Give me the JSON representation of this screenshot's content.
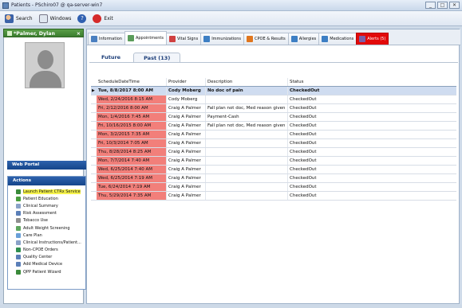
{
  "window": {
    "title": "Patients - PSchiro07 @ qa-server-win7",
    "buttons": [
      "_",
      "□",
      "✕"
    ]
  },
  "toolbar": {
    "search": "Search",
    "windows": "Windows",
    "exit": "Exit"
  },
  "patient": {
    "name": "*Palmer, Dylan",
    "close": "×"
  },
  "left": {
    "web_portal": "Web Portal",
    "actions_title": "Actions",
    "actions": [
      {
        "label": "Launch Patient CTRx Service",
        "color": "#3a8a3a"
      },
      {
        "label": "Patient Education",
        "color": "#4a9e3e"
      },
      {
        "label": "Clinical Summary",
        "color": "#8aa2c8"
      },
      {
        "label": "Risk Assessment",
        "color": "#5b7fb8"
      },
      {
        "label": "Tobacco Use",
        "color": "#8f8f8f"
      },
      {
        "label": "Adult Weight Screening",
        "color": "#5ea55e"
      },
      {
        "label": "Care Plan",
        "color": "#6aa0d8"
      },
      {
        "label": "Clinical Instructions/Patient...",
        "color": "#8aa2c8"
      },
      {
        "label": "Non-CPOE Orders",
        "color": "#2f8f4f"
      },
      {
        "label": "Quality Center",
        "color": "#5b7fb8"
      },
      {
        "label": "Add Medical Device",
        "color": "#5b7fb8"
      },
      {
        "label": "QPP Patient Wizard",
        "color": "#3a8a3a"
      }
    ]
  },
  "tabs": [
    {
      "label": "Information",
      "icon": "person-icon",
      "color": "#4a7fc0"
    },
    {
      "label": "Appointments",
      "icon": "calendar-icon",
      "color": "#5a9c5a"
    },
    {
      "label": "Vital Signs",
      "icon": "heart-icon",
      "color": "#d04040"
    },
    {
      "label": "Immunizations",
      "icon": "syringe-icon",
      "color": "#3d7fc4"
    },
    {
      "label": "CPOE & Results",
      "icon": "orders-icon",
      "color": "#e0761e"
    },
    {
      "label": "Allergies",
      "icon": "syringe-icon",
      "color": "#3d7fc4"
    },
    {
      "label": "Medications",
      "icon": "syringe-icon",
      "color": "#3d7fc4"
    },
    {
      "label": "Alerts (5)",
      "icon": "alert-icon",
      "color": "#7a5fa8"
    }
  ],
  "subtabs": {
    "future": "Future",
    "past": "Past (13)"
  },
  "grid": {
    "headers": [
      "ScheduleDateTime",
      "Provider",
      "Description",
      "Status"
    ],
    "rows": [
      [
        "Tue, 8/8/2017 8:00 AM",
        "Cody Moberg",
        "No doc of pain",
        "CheckedOut"
      ],
      [
        "Wed, 2/24/2016 8:15 AM",
        "Cody Moberg",
        "",
        "CheckedOut"
      ],
      [
        "Fri, 2/12/2016 8:00 AM",
        "Craig A Palmer",
        "Fall plan not doc, Med reason given",
        "CheckedOut"
      ],
      [
        "Mon, 1/4/2016 7:45 AM",
        "Craig A Palmer",
        "Payment-Cash",
        "CheckedOut"
      ],
      [
        "Fri, 10/16/2015 8:00 AM",
        "Craig A Palmer",
        "Fall plan not doc, Med reason given",
        "CheckedOut"
      ],
      [
        "Mon, 3/2/2015 7:35 AM",
        "Craig A Palmer",
        "",
        "CheckedOut"
      ],
      [
        "Fri, 10/3/2014 7:05 AM",
        "Craig A Palmer",
        "",
        "CheckedOut"
      ],
      [
        "Thu, 8/28/2014 8:25 AM",
        "Craig A Palmer",
        "",
        "CheckedOut"
      ],
      [
        "Mon, 7/7/2014 7:40 AM",
        "Craig A Palmer",
        "",
        "CheckedOut"
      ],
      [
        "Wed, 6/25/2014 7:40 AM",
        "Craig A Palmer",
        "",
        "CheckedOut"
      ],
      [
        "Wed, 6/25/2014 7:19 AM",
        "Craig A Palmer",
        "",
        "CheckedOut"
      ],
      [
        "Tue, 6/24/2014 7:19 AM",
        "Craig A Palmer",
        "",
        "CheckedOut"
      ],
      [
        "Thu, 5/29/2014 7:35 AM",
        "Craig A Palmer",
        "",
        "CheckedOut"
      ]
    ],
    "selected_index": 0
  }
}
